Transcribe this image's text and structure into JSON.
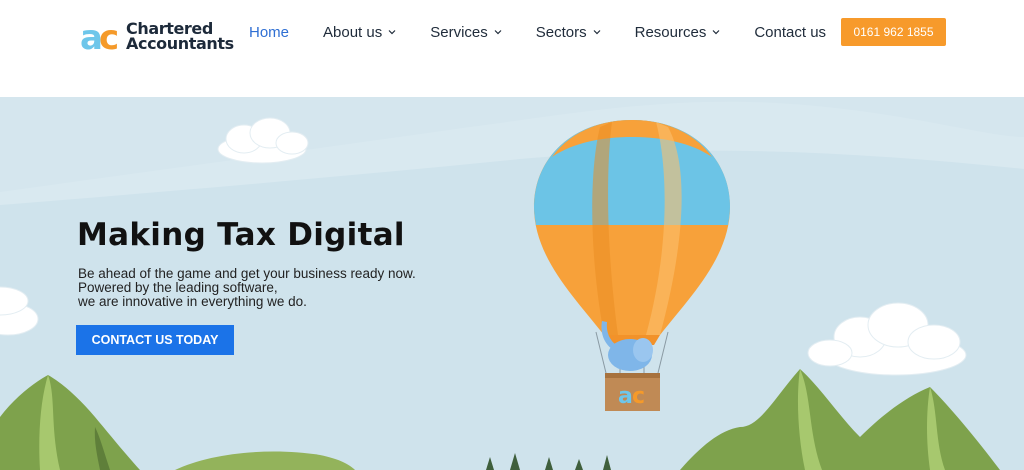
{
  "brand": {
    "line1": "Chartered",
    "line2": "Accountants",
    "colors": {
      "a": "#6ec6ea",
      "c": "#f59a2a",
      "text": "#1d2a3a"
    }
  },
  "nav": {
    "items": [
      {
        "label": "Home",
        "active": true,
        "has_dropdown": false
      },
      {
        "label": "About us",
        "active": false,
        "has_dropdown": true
      },
      {
        "label": "Services",
        "active": false,
        "has_dropdown": true
      },
      {
        "label": "Sectors",
        "active": false,
        "has_dropdown": true
      },
      {
        "label": "Resources",
        "active": false,
        "has_dropdown": true
      },
      {
        "label": "Contact us",
        "active": false,
        "has_dropdown": false
      }
    ],
    "phone": "0161 962 1855",
    "colors": {
      "active": "#2f6fd3",
      "phone_bg": "#f79a2b"
    }
  },
  "hero": {
    "title": "Making Tax Digital",
    "lines": [
      "Be ahead of the game and get your business ready now.",
      "Powered by the leading software,",
      "we are innovative in everything we do."
    ],
    "cta_label": "CONTACT US TODAY",
    "colors": {
      "sky": "#d6e7ef",
      "cta_bg": "#1b73e8",
      "balloon_orange": "#f7a13a",
      "balloon_blue": "#6cc4e6",
      "hills": "#7fa04e"
    }
  }
}
